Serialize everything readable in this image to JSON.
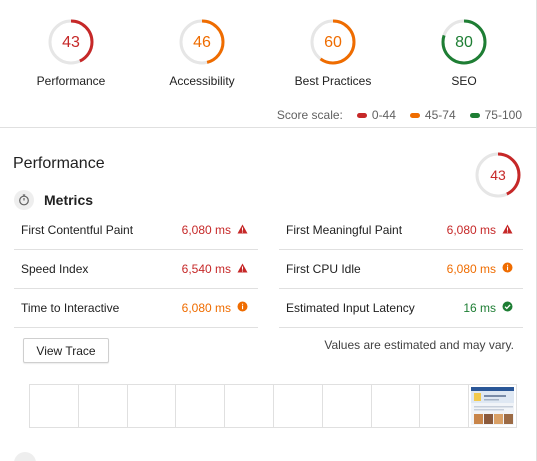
{
  "gauges": [
    {
      "score": "43",
      "label": "Performance",
      "color": "#c62828",
      "fraction": 0.43
    },
    {
      "score": "46",
      "label": "Accessibility",
      "color": "#ef6c00",
      "fraction": 0.46
    },
    {
      "score": "60",
      "label": "Best Practices",
      "color": "#ef6c00",
      "fraction": 0.6
    },
    {
      "score": "80",
      "label": "SEO",
      "color": "#1e7e34",
      "fraction": 0.8
    }
  ],
  "scale": {
    "label": "Score scale:",
    "items": [
      {
        "text": "0-44",
        "color": "#c62828"
      },
      {
        "text": "45-74",
        "color": "#ef6c00"
      },
      {
        "text": "75-100",
        "color": "#1e7e34"
      }
    ]
  },
  "performance": {
    "title": "Performance",
    "score": "43",
    "fraction": 0.43,
    "color": "#c62828",
    "metrics_title": "Metrics",
    "metrics": [
      {
        "label": "First Contentful Paint",
        "value": "6,080 ms",
        "status": "fail",
        "color": "#c62828",
        "column": "left",
        "row": 0
      },
      {
        "label": "First Meaningful Paint",
        "value": "6,080 ms",
        "status": "fail",
        "color": "#c62828",
        "column": "right",
        "row": 0
      },
      {
        "label": "Speed Index",
        "value": "6,540 ms",
        "status": "fail",
        "color": "#c62828",
        "column": "left",
        "row": 1
      },
      {
        "label": "First CPU Idle",
        "value": "6,080 ms",
        "status": "average",
        "color": "#ef6c00",
        "column": "right",
        "row": 1
      },
      {
        "label": "Time to Interactive",
        "value": "6,080 ms",
        "status": "average",
        "color": "#ef6c00",
        "column": "left",
        "row": 2
      },
      {
        "label": "Estimated Input Latency",
        "value": "16 ms",
        "status": "pass",
        "color": "#1e7e34",
        "column": "right",
        "row": 2
      }
    ],
    "view_trace_label": "View Trace",
    "estimate_note": "Values are estimated and may vary."
  },
  "icons": {
    "fail": "warning-triangle-icon",
    "average": "info-circle-icon",
    "pass": "check-circle-icon",
    "metrics": "stopwatch-icon"
  }
}
